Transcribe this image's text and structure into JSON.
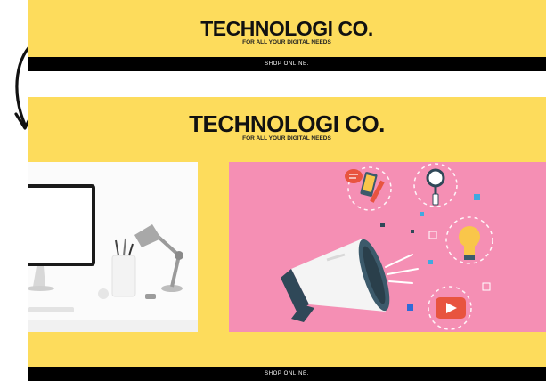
{
  "top_banner": {
    "title": "TECHNOLOGI CO.",
    "tagline": "FOR ALL YOUR DIGITAL NEEDS",
    "shop_label": "SHOP ONLINE."
  },
  "main_banner": {
    "title": "TECHNOLOGI CO.",
    "tagline": "FOR ALL YOUR DIGITAL NEEDS",
    "shop_label": "SHOP ONLINE."
  },
  "colors": {
    "banner_yellow": "#fddc5c",
    "promo_pink": "#f58fb4",
    "bar_black": "#000000"
  },
  "icons": [
    "curved-arrow-icon",
    "megaphone-icon",
    "magnifier-icon",
    "lightbulb-icon",
    "play-button-icon",
    "chat-bubble-icon",
    "phone-pencil-icon"
  ]
}
